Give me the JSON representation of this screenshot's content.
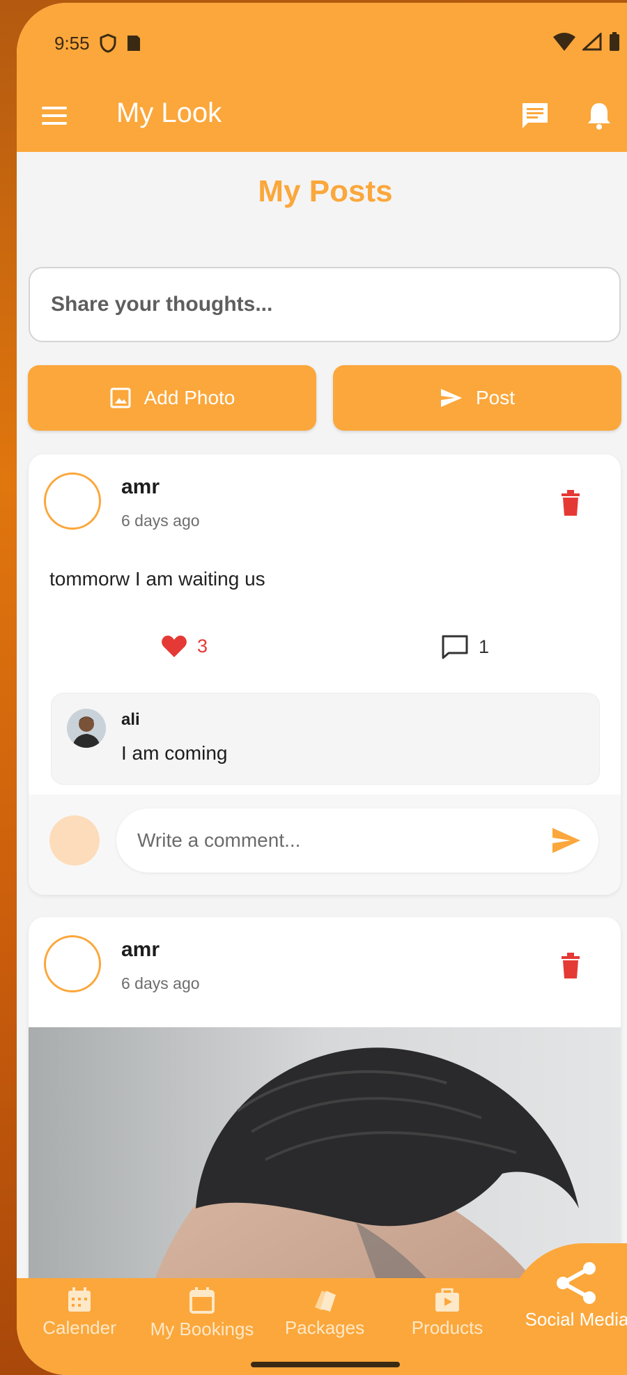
{
  "status_bar": {
    "time": "9:55"
  },
  "app_bar": {
    "title": "My Look"
  },
  "page": {
    "title": "My Posts"
  },
  "composer": {
    "placeholder": "Share your thoughts...",
    "add_photo_label": "Add Photo",
    "post_label": "Post"
  },
  "posts": [
    {
      "author": "amr",
      "time": "6 days ago",
      "text": "tommorw I am waiting us",
      "likes": "3",
      "comments": "1",
      "comment_list": [
        {
          "author": "ali",
          "text": "I am coming"
        }
      ],
      "comment_placeholder": "Write a comment..."
    },
    {
      "author": "amr",
      "time": "6 days ago"
    }
  ],
  "bottom_nav": {
    "items": [
      {
        "label": "Calender",
        "icon": "calendar-icon"
      },
      {
        "label": "My Bookings",
        "icon": "calendar-outline-icon"
      },
      {
        "label": "Packages",
        "icon": "packages-icon"
      },
      {
        "label": "Products",
        "icon": "shopping-bag-icon"
      },
      {
        "label": "Social Media",
        "icon": "share-icon",
        "active": true
      }
    ]
  },
  "colors": {
    "primary": "#fba73b",
    "delete": "#e53935",
    "like": "#e53935"
  }
}
